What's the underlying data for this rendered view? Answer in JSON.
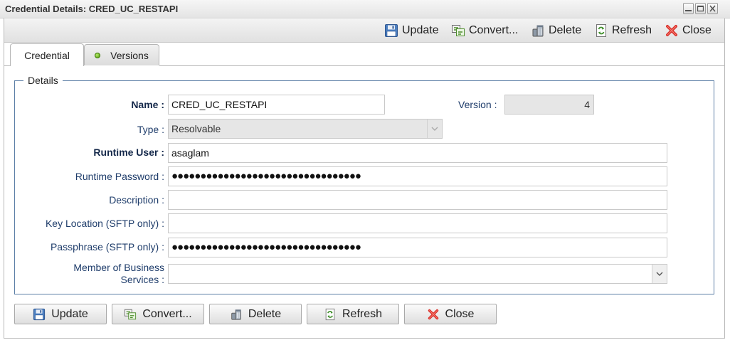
{
  "window": {
    "title": "Credential Details: CRED_UC_RESTAPI"
  },
  "toolbar": {
    "update_label": "Update",
    "convert_label": "Convert...",
    "delete_label": "Delete",
    "refresh_label": "Refresh",
    "close_label": "Close"
  },
  "tabs": [
    {
      "label": "Credential",
      "active": true
    },
    {
      "label": "Versions",
      "active": false,
      "status_color": "#4e9a06"
    }
  ],
  "details": {
    "legend": "Details",
    "name": {
      "label": "Name :",
      "value": "CRED_UC_RESTAPI"
    },
    "version": {
      "label": "Version :",
      "value": "4"
    },
    "type": {
      "label": "Type :",
      "value": "Resolvable"
    },
    "runtime_user": {
      "label": "Runtime User :",
      "value": "asaglam"
    },
    "runtime_password": {
      "label": "Runtime Password :",
      "value": "●●●●●●●●●●●●●●●●●●●●●●●●●●●●●●●●●"
    },
    "description": {
      "label": "Description :",
      "value": ""
    },
    "key_location": {
      "label": "Key Location (SFTP only) :",
      "value": ""
    },
    "passphrase": {
      "label": "Passphrase (SFTP only) :",
      "value": "●●●●●●●●●●●●●●●●●●●●●●●●●●●●●●●●●"
    },
    "business_services": {
      "label_line1": "Member of Business",
      "label_line2": "Services :",
      "value": ""
    }
  },
  "footer": {
    "update_label": "Update",
    "convert_label": "Convert...",
    "delete_label": "Delete",
    "refresh_label": "Refresh",
    "close_label": "Close"
  },
  "colors": {
    "label_blue": "#1f3d6b",
    "border_blue": "#5c7fa6",
    "close_red": "#d9302a"
  }
}
